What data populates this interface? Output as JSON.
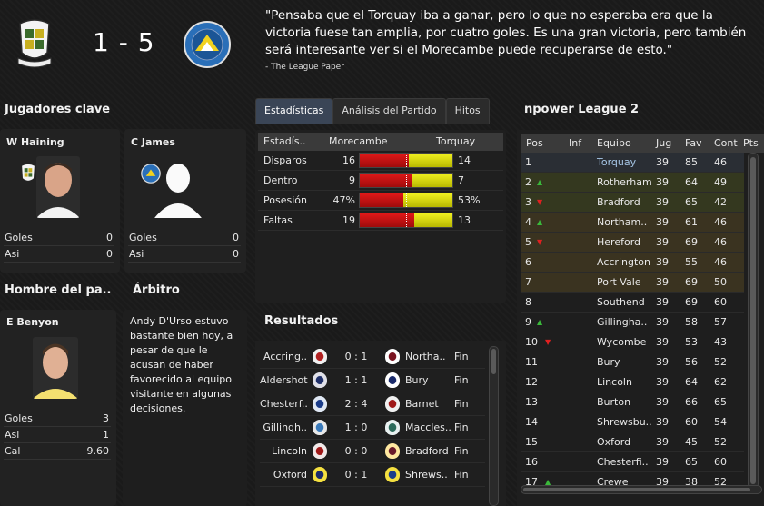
{
  "match": {
    "score": "1 - 5",
    "quote": "\"Pensaba que el Torquay iba a ganar, pero lo que no esperaba era que la victoria fuese tan amplia, por cuatro goles. Es una gran victoria, pero también será interesante ver si el Morecambe puede recuperarse de esto.\"",
    "quote_source": "- The League Paper"
  },
  "colors": {
    "home": "#e01818",
    "away": "#e8e820",
    "tab_active": "#3a4556",
    "promotion_bg": "#34381f",
    "playoff_bg": "#3a3320",
    "up_arrow": "#3ab83a",
    "down_arrow": "#e02020"
  },
  "key_players": {
    "heading": "Jugadores clave",
    "players": [
      {
        "name": "W Haining",
        "stats": [
          {
            "label": "Goles",
            "value": "0"
          },
          {
            "label": "Asi",
            "value": "0"
          }
        ]
      },
      {
        "name": "C James",
        "stats": [
          {
            "label": "Goles",
            "value": "0"
          },
          {
            "label": "Asi",
            "value": "0"
          }
        ]
      }
    ]
  },
  "man_of_match": {
    "heading": "Hombre del pa..",
    "name": "E Benyon",
    "stats": [
      {
        "label": "Goles",
        "value": "3"
      },
      {
        "label": "Asi",
        "value": "1"
      },
      {
        "label": "Cal",
        "value": "9.60"
      }
    ]
  },
  "referee": {
    "heading": "Árbitro",
    "text": "Andy D'Urso estuvo bastante bien hoy, a pesar de que le acusan de haber favorecido al equipo visitante en algunas decisiones."
  },
  "tabs": [
    "Estadísticas",
    "Análisis del Partido",
    "Hitos"
  ],
  "stats": {
    "headers": {
      "label": "Estadís..",
      "home": "Morecambe",
      "away": "Torquay"
    },
    "rows": [
      {
        "label": "Disparos",
        "home": "16",
        "away": "14",
        "home_share": 0.53
      },
      {
        "label": "Dentro",
        "home": "9",
        "away": "7",
        "home_share": 0.56
      },
      {
        "label": "Posesión",
        "home": "47%",
        "away": "53%",
        "home_share": 0.47
      },
      {
        "label": "Faltas",
        "home": "19",
        "away": "13",
        "home_share": 0.59
      }
    ]
  },
  "results": {
    "heading": "Resultados",
    "rows": [
      {
        "home": "Accring..",
        "score": "0 : 1",
        "away": "Northa..",
        "status": "Fin"
      },
      {
        "home": "Aldershot",
        "score": "1 : 1",
        "away": "Bury",
        "status": "Fin"
      },
      {
        "home": "Chesterf..",
        "score": "2 : 4",
        "away": "Barnet",
        "status": "Fin"
      },
      {
        "home": "Gillingh..",
        "score": "1 : 0",
        "away": "Maccles..",
        "status": "Fin"
      },
      {
        "home": "Lincoln",
        "score": "0 : 0",
        "away": "Bradford",
        "status": "Fin"
      },
      {
        "home": "Oxford",
        "score": "0 : 1",
        "away": "Shrews..",
        "status": "Fin"
      }
    ]
  },
  "league": {
    "heading": "npower League 2",
    "headers": {
      "pos": "Pos",
      "inf": "Inf",
      "team": "Equipo",
      "jug": "Jug",
      "fav": "Fav",
      "cont": "Cont",
      "pts": "Pts"
    },
    "rows": [
      {
        "pos": "1",
        "move": "",
        "team": "Torquay",
        "jug": "39",
        "fav": "85",
        "cont": "46"
      },
      {
        "pos": "2",
        "move": "up",
        "team": "Rotherham",
        "jug": "39",
        "fav": "64",
        "cont": "49"
      },
      {
        "pos": "3",
        "move": "down",
        "team": "Bradford",
        "jug": "39",
        "fav": "65",
        "cont": "42"
      },
      {
        "pos": "4",
        "move": "up",
        "team": "Northam..",
        "jug": "39",
        "fav": "61",
        "cont": "46"
      },
      {
        "pos": "5",
        "move": "down",
        "team": "Hereford",
        "jug": "39",
        "fav": "69",
        "cont": "46"
      },
      {
        "pos": "6",
        "move": "",
        "team": "Accrington",
        "jug": "39",
        "fav": "55",
        "cont": "46"
      },
      {
        "pos": "7",
        "move": "",
        "team": "Port Vale",
        "jug": "39",
        "fav": "69",
        "cont": "50"
      },
      {
        "pos": "8",
        "move": "",
        "team": "Southend",
        "jug": "39",
        "fav": "69",
        "cont": "60"
      },
      {
        "pos": "9",
        "move": "up",
        "team": "Gillingha..",
        "jug": "39",
        "fav": "58",
        "cont": "57"
      },
      {
        "pos": "10",
        "move": "down",
        "team": "Wycombe",
        "jug": "39",
        "fav": "53",
        "cont": "43"
      },
      {
        "pos": "11",
        "move": "",
        "team": "Bury",
        "jug": "39",
        "fav": "56",
        "cont": "52"
      },
      {
        "pos": "12",
        "move": "",
        "team": "Lincoln",
        "jug": "39",
        "fav": "64",
        "cont": "62"
      },
      {
        "pos": "13",
        "move": "",
        "team": "Burton",
        "jug": "39",
        "fav": "66",
        "cont": "65"
      },
      {
        "pos": "14",
        "move": "",
        "team": "Shrewsbu..",
        "jug": "39",
        "fav": "60",
        "cont": "54"
      },
      {
        "pos": "15",
        "move": "",
        "team": "Oxford",
        "jug": "39",
        "fav": "45",
        "cont": "52"
      },
      {
        "pos": "16",
        "move": "",
        "team": "Chesterfi..",
        "jug": "39",
        "fav": "65",
        "cont": "60"
      },
      {
        "pos": "17",
        "move": "up",
        "team": "Crewe",
        "jug": "39",
        "fav": "38",
        "cont": "52"
      }
    ]
  }
}
